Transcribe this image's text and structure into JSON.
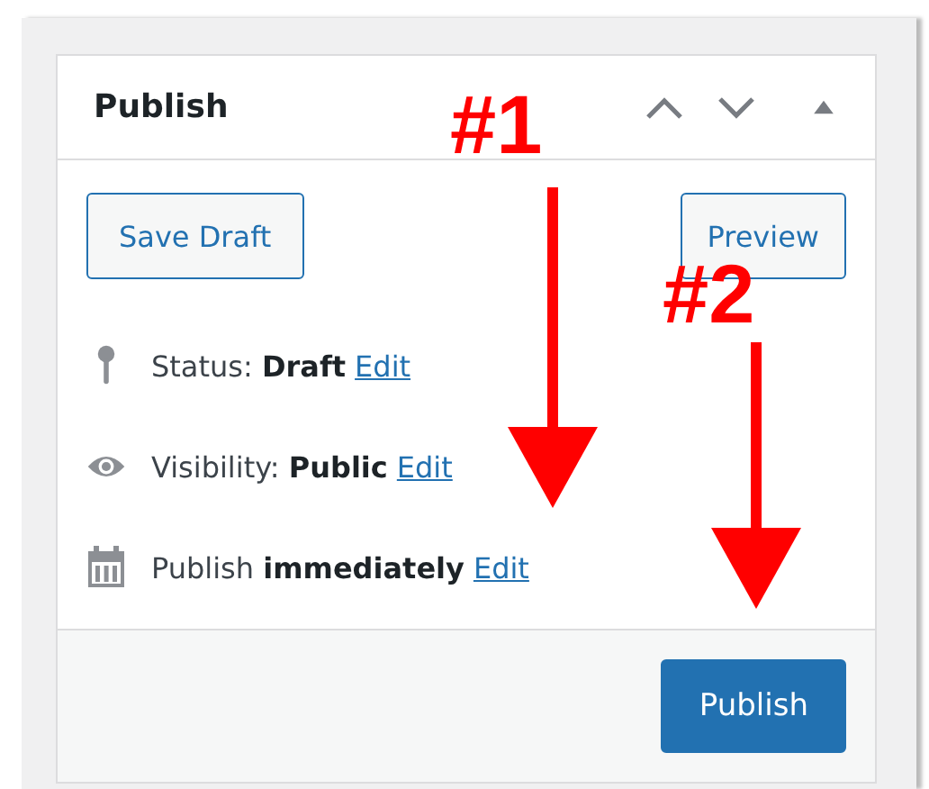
{
  "box": {
    "title": "Publish",
    "header_controls": [
      {
        "kind": "up"
      },
      {
        "kind": "down"
      },
      {
        "kind": "toggle"
      }
    ],
    "actions": [
      "Save Draft",
      "Preview"
    ],
    "meta": [
      {
        "kind": "status",
        "text": "Status: **Draft**",
        "link": "Edit"
      },
      {
        "kind": "visibility",
        "text": "Visibility: **Public**",
        "link": "Edit"
      },
      {
        "kind": "schedule",
        "text": "Publish **immediately**",
        "link": "Edit"
      }
    ],
    "primary_button": "Publish"
  },
  "annotations": [
    {
      "label": "#1"
    },
    {
      "label": "#2"
    }
  ]
}
